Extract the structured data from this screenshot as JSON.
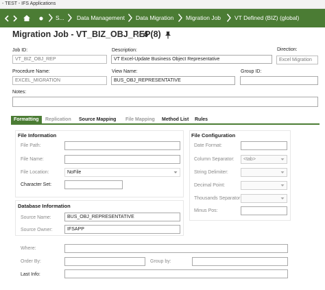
{
  "window": {
    "title": "- TEST - IFS Applications"
  },
  "breadcrumb": {
    "root": "S...",
    "items": [
      "Data Management",
      "Data Migration",
      "Migration Job",
      "VT Defined (BIZ) (global)"
    ]
  },
  "page": {
    "title": "Migration Job - VT_BIZ_OBJ_REP",
    "count": "4 (8)"
  },
  "header_fields": {
    "job_id": {
      "label": "Job ID:",
      "value": "VT_BIZ_OBJ_REP"
    },
    "description": {
      "label": "Description:",
      "value": "VT Excel-Update Business Object Representative"
    },
    "direction": {
      "label": "Direction:",
      "value": "Excel Migration"
    },
    "procedure_name": {
      "label": "Procedure Name:",
      "value": "EXCEL_MIGRATION"
    },
    "view_name": {
      "label": "View Name:",
      "value": "BUS_OBJ_REPRESENTATIVE"
    },
    "group_id": {
      "label": "Group ID:",
      "value": ""
    },
    "notes": {
      "label": "Notes:",
      "value": ""
    }
  },
  "tabs": [
    "Formatting",
    "Replication",
    "Source Mapping",
    "File Mapping",
    "Method List",
    "Rules"
  ],
  "file_information": {
    "title": "File Information",
    "file_path": {
      "label": "File Path:",
      "value": ""
    },
    "file_name": {
      "label": "File Name:",
      "value": ""
    },
    "file_location": {
      "label": "File Location:",
      "value": "NoFile"
    },
    "character_set": {
      "label": "Character Set:",
      "value": ""
    }
  },
  "file_configuration": {
    "title": "File Configuration",
    "date_format": {
      "label": "Date Format:",
      "value": ""
    },
    "column_separator": {
      "label": "Column Separator:",
      "value": "<tab>"
    },
    "string_delimiter": {
      "label": "String Delimiter:",
      "value": ""
    },
    "decimal_point": {
      "label": "Decimal Point:",
      "value": ""
    },
    "thousands_separator": {
      "label": "Thousands Separator",
      "value": ""
    },
    "minus_pos": {
      "label": "Minus Pos:",
      "value": ""
    }
  },
  "database_information": {
    "title": "Database Information",
    "source_name": {
      "label": "Source Name:",
      "value": "BUS_OBJ_REPRESENTATIVE"
    },
    "source_owner": {
      "label": "Source Owner:",
      "value": "IFSAPP"
    }
  },
  "query": {
    "where": {
      "label": "Where:",
      "value": ""
    },
    "order_by": {
      "label": "Order By:",
      "value": ""
    },
    "group_by": {
      "label": "Group by:",
      "value": ""
    },
    "last_info": {
      "label": "Last Info:",
      "value": ""
    }
  },
  "colors": {
    "brand_green": "#4b7c34",
    "muted_text": "#8a8a8a"
  },
  "icons": [
    "back-icon",
    "forward-icon",
    "home-icon",
    "dot-icon",
    "chevron-right-icon",
    "chevron-down-icon",
    "pin-icon",
    "dropdown-caret-icon"
  ]
}
